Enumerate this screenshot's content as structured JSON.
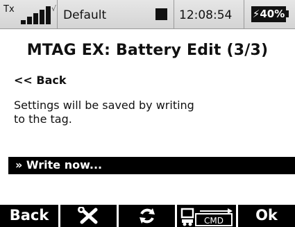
{
  "status_bar": {
    "tx_label": "Tx",
    "signal_tick": "√",
    "model_name": "Default",
    "time": "12:08:54",
    "battery": "⚡40%",
    "battery_level_percent": 40
  },
  "screen": {
    "title": "MTAG EX: Battery Edit (3/3)",
    "back_label": "<< Back",
    "description_line1": "Settings will be saved by writing",
    "description_line2": "to the tag.",
    "write_now_label": "» Write now..."
  },
  "softkeys": {
    "back_label": "Back",
    "tools_icon": "tools-icon",
    "refresh_icon": "refresh-icon",
    "cmd_icon": "cmd-icon",
    "cmd_text": "CMD",
    "ok_label": "Ok"
  }
}
